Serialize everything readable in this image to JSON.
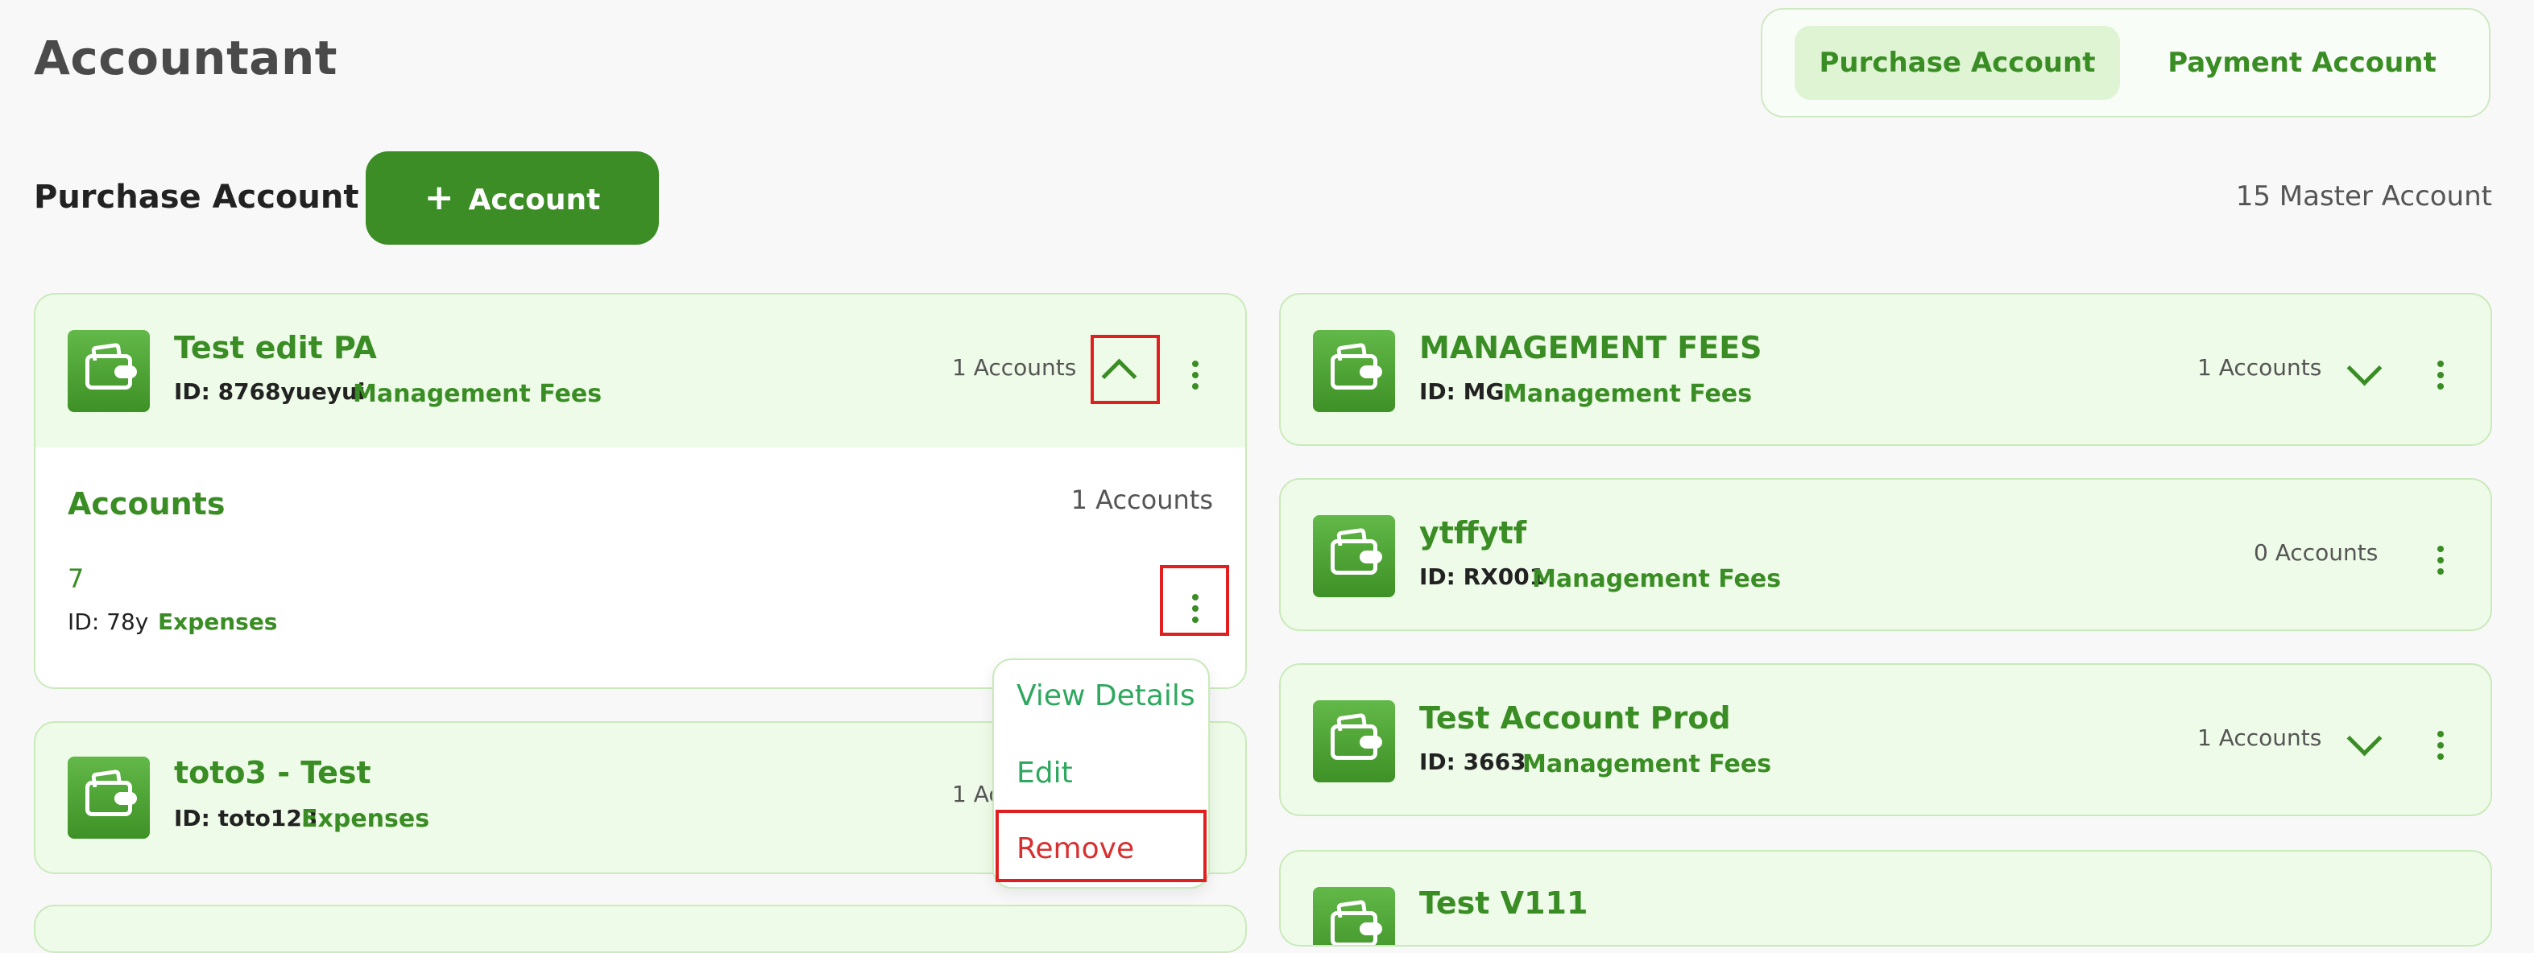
{
  "header": {
    "title": "Accountant"
  },
  "tabs": [
    {
      "label": "Purchase Account"
    },
    {
      "label": "Payment Account"
    }
  ],
  "section": {
    "title": "Purchase Account",
    "add_button": "Account",
    "master_count": "15 Master Account"
  },
  "colors": {
    "brand": "#3c8d25",
    "card_bg": "#eefbe8",
    "highlight": "#e02020",
    "remove": "#d83030"
  },
  "left_cards": [
    {
      "name": "Test edit PA",
      "id": "ID: 8768yueyui",
      "category": "Management Fees",
      "count": "1 Accounts",
      "expanded": {
        "title": "Accounts",
        "count": "1 Accounts",
        "item": {
          "name": "7",
          "id": "ID: 78y",
          "category": "Expenses"
        }
      }
    },
    {
      "name": "toto3 - Test",
      "id": "ID: toto123",
      "category": "Expenses",
      "count": "1 Ac"
    }
  ],
  "right_cards": [
    {
      "name": "MANAGEMENT FEES",
      "id": "ID: MG",
      "category": "Management Fees",
      "count": "1 Accounts"
    },
    {
      "name": "ytffytf",
      "id": "ID: RX001",
      "category": "Management Fees",
      "count": "0 Accounts"
    },
    {
      "name": "Test Account Prod",
      "id": "ID: 3663",
      "category": "Management Fees",
      "count": "1 Accounts"
    },
    {
      "name": "Test V111"
    }
  ],
  "context_menu": {
    "view": "View Details",
    "edit": "Edit",
    "remove": "Remove"
  }
}
